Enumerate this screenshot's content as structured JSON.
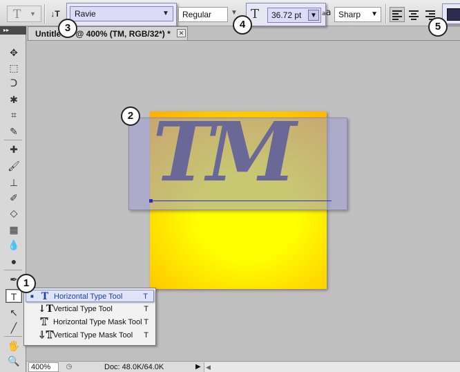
{
  "options_bar": {
    "tool_preset_glyph": "T",
    "tool_preset_arrow": "▼",
    "orientation_glyph": "↓T",
    "font_family": "Ravie",
    "font_style": "Regular",
    "font_size": "36.72 pt",
    "font_size_glyph": "T",
    "anti_alias_glyph": "a",
    "anti_alias_glyph_small": "a",
    "anti_alias": "Sharp",
    "dropdown_arrow": "▼",
    "text_color": "#2d2b4f"
  },
  "toolbox": {
    "grip_label": "▸▸",
    "tools": [
      "✥",
      "⬚",
      "ᑐ",
      "✱",
      "⌗",
      "✎",
      "✚",
      "🖌",
      "⊥",
      "✐",
      "◇",
      "▦",
      "💧",
      "●",
      "✒",
      "T",
      "↖",
      "╱",
      "🖐",
      "🔍"
    ]
  },
  "document": {
    "tab_title": "Untitled-1 @ 400% (TM, RGB/32*) *",
    "close_glyph": "✕",
    "text_content": "TM"
  },
  "flyout": {
    "items": [
      {
        "icon": "T",
        "label": "Horizontal Type Tool",
        "key": "T",
        "selected": true
      },
      {
        "icon": "↓T",
        "label": "Vertical Type Tool",
        "key": "T",
        "selected": false
      },
      {
        "icon": "T",
        "label": "Horizontal Type Mask Tool",
        "key": "T",
        "selected": false
      },
      {
        "icon": "↓T",
        "label": "Vertical Type Mask Tool",
        "key": "T",
        "selected": false
      }
    ],
    "bullet": "■"
  },
  "callouts": [
    "1",
    "2",
    "3",
    "4",
    "5"
  ],
  "status": {
    "zoom": "400%",
    "doc_icon": "◷",
    "doc_info": "Doc: 48.0K/64.0K",
    "arrow": "▶",
    "scroll_left": "◀"
  }
}
